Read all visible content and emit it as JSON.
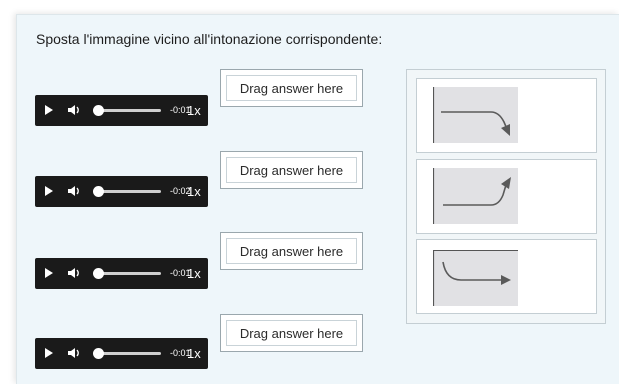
{
  "instruction": "Sposta l'immagine vicino all'intonazione corrispondente:",
  "players": [
    {
      "time": "-0:01",
      "speed": "1x"
    },
    {
      "time": "-0:02",
      "speed": "1x"
    },
    {
      "time": "-0:01",
      "speed": "1x"
    },
    {
      "time": "-0:01",
      "speed": "1x"
    }
  ],
  "dropzones": [
    {
      "label": "Drag answer here"
    },
    {
      "label": "Drag answer here"
    },
    {
      "label": "Drag answer here"
    },
    {
      "label": "Drag answer here"
    }
  ],
  "draggable_images": [
    {
      "icon": "falling-intonation-arrow-icon"
    },
    {
      "icon": "rising-intonation-arrow-icon"
    },
    {
      "icon": "fall-then-level-intonation-arrow-icon"
    }
  ],
  "colors": {
    "panel_bg": "#eef6fa",
    "player_bg": "#1a1a1a",
    "image_bg": "#e1e1e4",
    "arrow": "#5a5a5a"
  }
}
